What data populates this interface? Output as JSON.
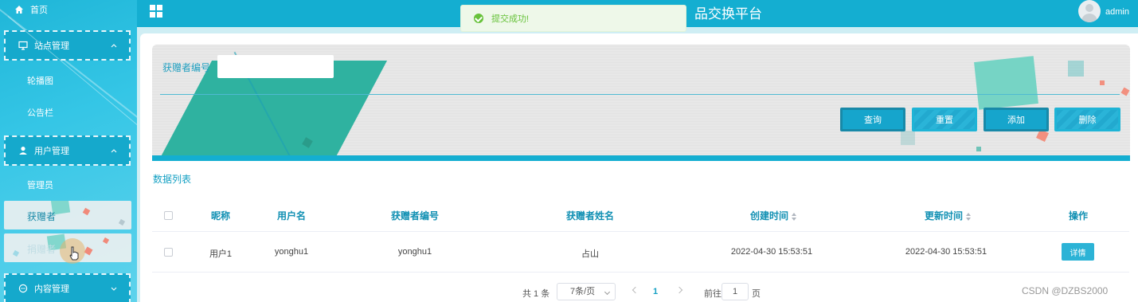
{
  "header": {
    "title": "品交换平台",
    "user": "admin"
  },
  "toast": {
    "message": "提交成功!",
    "color": "#67c23a"
  },
  "sidebar": {
    "home": "首页",
    "groups": [
      {
        "label": "站点管理",
        "icon": "monitor-icon",
        "items": [
          "轮播图",
          "公告栏"
        ]
      },
      {
        "label": "用户管理",
        "icon": "user-icon",
        "items": [
          "管理员",
          "获赠者",
          "捐赠者"
        ]
      },
      {
        "label": "内容管理",
        "icon": "chat-icon",
        "items": []
      }
    ]
  },
  "search": {
    "label": "获赠者编号",
    "value": "",
    "buttons": {
      "query": "查询",
      "reset": "重置",
      "add": "添加",
      "delete": "删除"
    }
  },
  "list": {
    "title": "数据列表",
    "columns": [
      "昵称",
      "用户名",
      "获赠者编号",
      "获赠者姓名",
      "创建时间",
      "更新时间",
      "操作"
    ],
    "rows": [
      {
        "nickname": "用户1",
        "username": "yonghu1",
        "recipient_no": "yonghu1",
        "recipient_name": "占山",
        "created": "2022-04-30 15:53:51",
        "updated": "2022-04-30 15:53:51",
        "action": "详情"
      }
    ]
  },
  "pagination": {
    "total": "共 1 条",
    "page_size": "7条/页",
    "current_page": "1",
    "goto_label": "前往",
    "goto_value": "1",
    "goto_suffix": "页"
  },
  "watermark": "CSDN @DZBS2000",
  "colors": {
    "accent": "#14aed1",
    "sidebar": "#35c6e6"
  }
}
